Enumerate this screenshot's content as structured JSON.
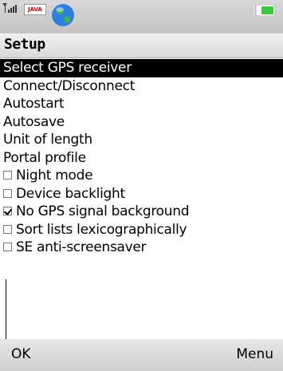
{
  "status_bar": {
    "signal_icon": "signal-strength-icon",
    "java_badge": "JAVA",
    "globe_icon": "globe-icon",
    "battery_icon": "battery-icon"
  },
  "title": "Setup",
  "menu_items": [
    {
      "label": "Select GPS receiver",
      "selected": true
    },
    {
      "label": "Connect/Disconnect"
    },
    {
      "label": "Autostart"
    },
    {
      "label": "Autosave"
    },
    {
      "label": "Unit of length"
    },
    {
      "label": "Portal profile"
    },
    {
      "label": "Night mode",
      "checkbox": true,
      "checked": false
    },
    {
      "label": "Device backlight",
      "checkbox": true,
      "checked": false
    },
    {
      "label": "No GPS signal background",
      "checkbox": true,
      "checked": true
    },
    {
      "label": "Sort lists lexicographically",
      "checkbox": true,
      "checked": false
    },
    {
      "label": "SE anti-screensaver",
      "checkbox": true,
      "checked": false
    }
  ],
  "softkeys": {
    "left": "OK",
    "right": "Menu"
  },
  "colors": {
    "selection_bg": "#000000",
    "battery_green": "#3cc83c"
  }
}
